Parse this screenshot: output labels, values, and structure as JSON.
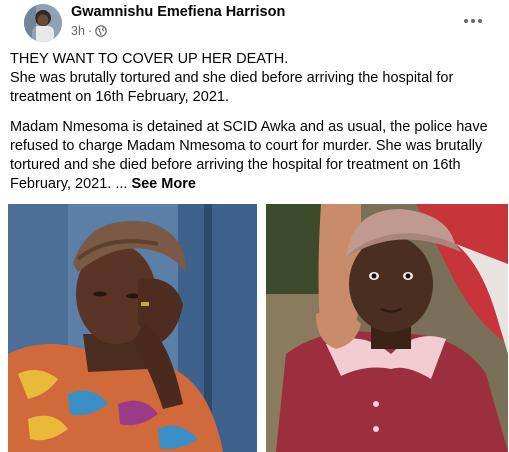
{
  "post": {
    "author": "Gwamnishu Emefiena Harrison",
    "time": "3h",
    "dot": "·",
    "more_icon": "more-horizontal-icon",
    "privacy_icon": "globe-icon",
    "paragraph_1_line_1": "THEY WANT TO COVER UP HER DEATH.",
    "paragraph_1_line_2": "She was brutally tortured and she died before arriving the hospital for treatment on 16th February, 2021.",
    "paragraph_2": "Madam Nmesoma is detained at SCID Awka and as usual, the police have refused to charge Madam Nmesoma to court for murder. She was brutally tortured and she died before arriving the hospital for treatment on 16th February, 2021. ...",
    "see_more": "See More"
  },
  "colors": {
    "author": "#050505",
    "meta": "#65676b",
    "background": "#ffffff"
  }
}
